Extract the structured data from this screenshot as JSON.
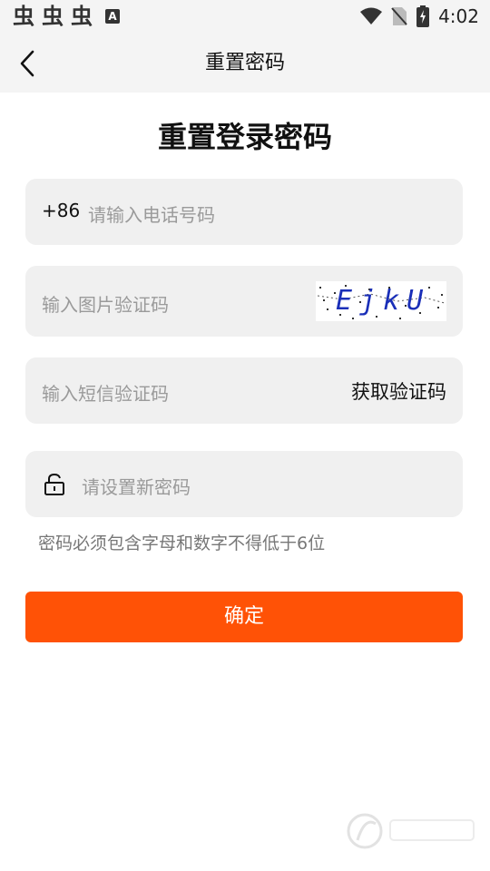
{
  "status_bar": {
    "app_glyphs": [
      "虫",
      "虫",
      "虫"
    ],
    "a_badge": "A",
    "time": "4:02"
  },
  "header": {
    "title": "重置密码"
  },
  "page": {
    "title": "重置登录密码"
  },
  "phone": {
    "prefix": "+86",
    "placeholder": "请输入电话号码"
  },
  "captcha": {
    "placeholder": "输入图片验证码",
    "code": "EjkU"
  },
  "sms": {
    "placeholder": "输入短信验证码",
    "get_code_label": "获取验证码"
  },
  "password": {
    "placeholder": "请设置新密码",
    "hint": "密码必须包含字母和数字不得低于6位"
  },
  "confirm": {
    "label": "确定"
  },
  "colors": {
    "accent": "#ff5206",
    "field_bg": "#f0f0f0",
    "header_bg": "#f4f4f4"
  },
  "icons": [
    "back-arrow-icon",
    "lock-icon",
    "wifi-icon",
    "no-sim-icon",
    "battery-icon"
  ]
}
